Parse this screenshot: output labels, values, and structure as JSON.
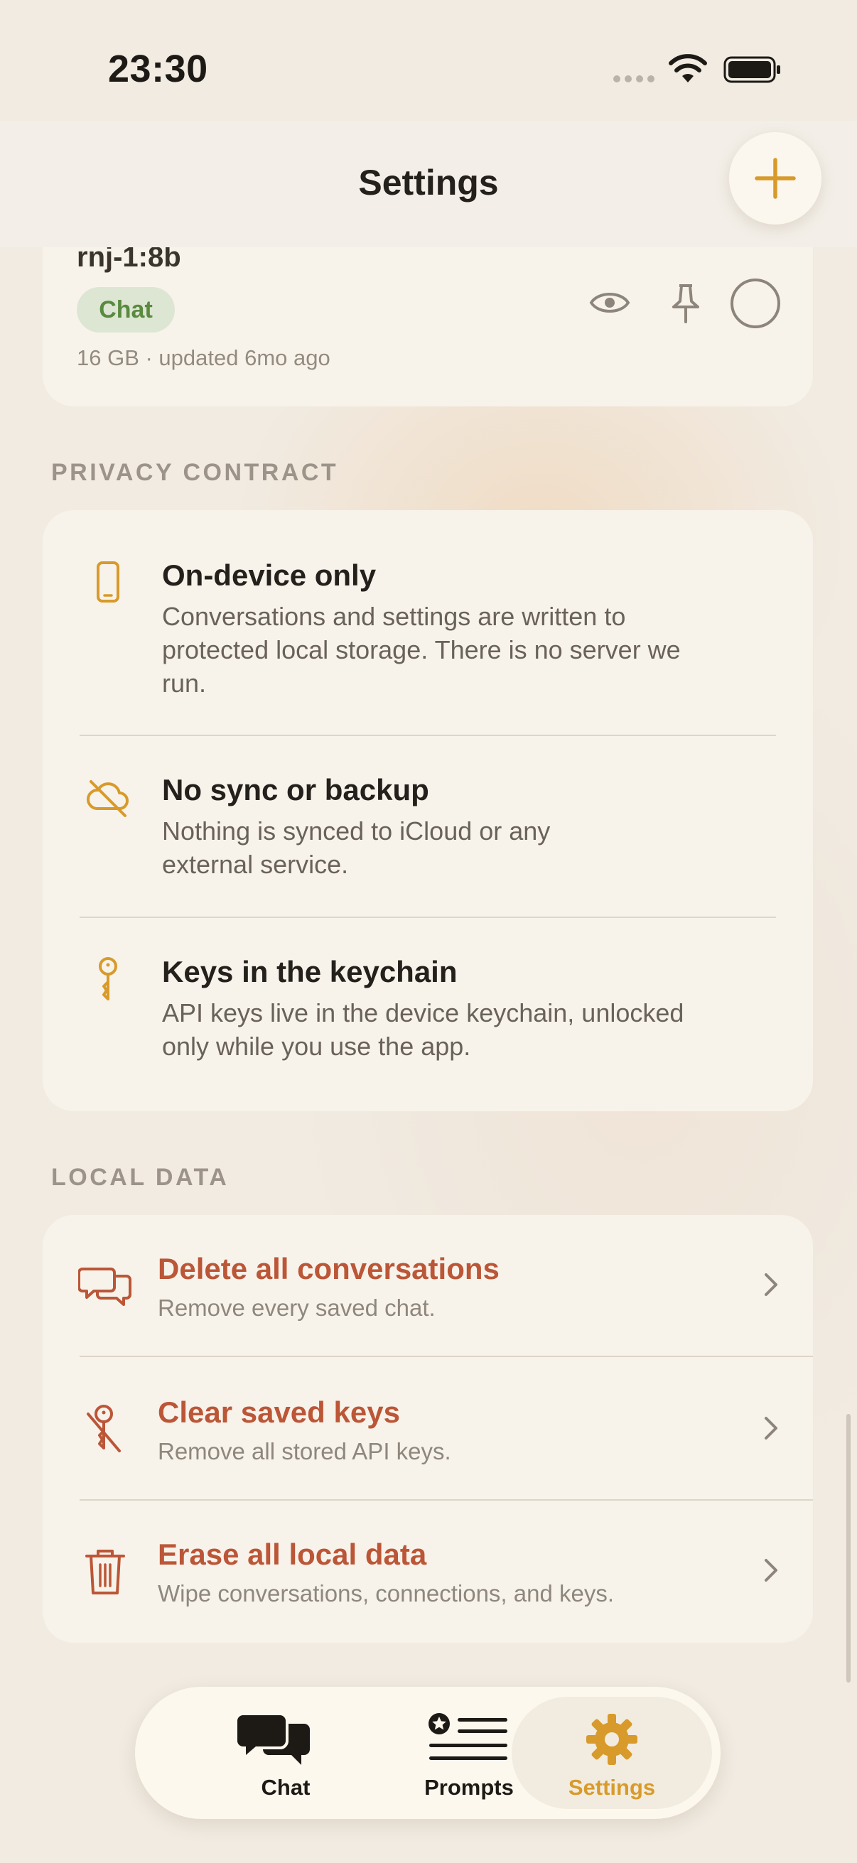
{
  "status_bar": {
    "time": "23:30"
  },
  "header": {
    "title": "Settings",
    "add_icon": "plus-icon"
  },
  "model_card": {
    "name": "rnj-1:8b",
    "badge": "Chat",
    "meta": "16 GB · updated 6mo ago"
  },
  "privacy": {
    "section_label": "PRIVACY CONTRACT",
    "items": [
      {
        "icon": "phone-icon",
        "title": "On-device only",
        "desc_lines": [
          "Conversations and settings are written to",
          "protected local storage. There is no server we",
          "run."
        ]
      },
      {
        "icon": "cloud-off-icon",
        "title": "No sync or backup",
        "desc_lines": [
          "Nothing is synced to iCloud or any",
          "external service."
        ]
      },
      {
        "icon": "key-icon",
        "title": "Keys in the keychain",
        "desc_lines": [
          "API keys live in the device keychain, unlocked",
          "only while you use the app."
        ]
      }
    ]
  },
  "local_data": {
    "section_label": "LOCAL DATA",
    "items": [
      {
        "icon": "chat-bubbles-icon",
        "title": "Delete all conversations",
        "desc": "Remove every saved chat."
      },
      {
        "icon": "key-slash-icon",
        "title": "Clear saved keys",
        "desc": "Remove all stored API keys."
      },
      {
        "icon": "trash-icon",
        "title": "Erase all local data",
        "desc": "Wipe conversations, connections, and keys."
      }
    ]
  },
  "tabs": [
    {
      "label": "Chat",
      "icon": "chat-bubbles-icon",
      "selected": false
    },
    {
      "label": "Prompts",
      "icon": "list-star-icon",
      "selected": false
    },
    {
      "label": "Settings",
      "icon": "gear-icon",
      "selected": true
    }
  ],
  "colors": {
    "accent": "#d89a2a",
    "destructive": "#bb5637",
    "background": "#f1ebe2",
    "card": "#f7f3eb"
  }
}
